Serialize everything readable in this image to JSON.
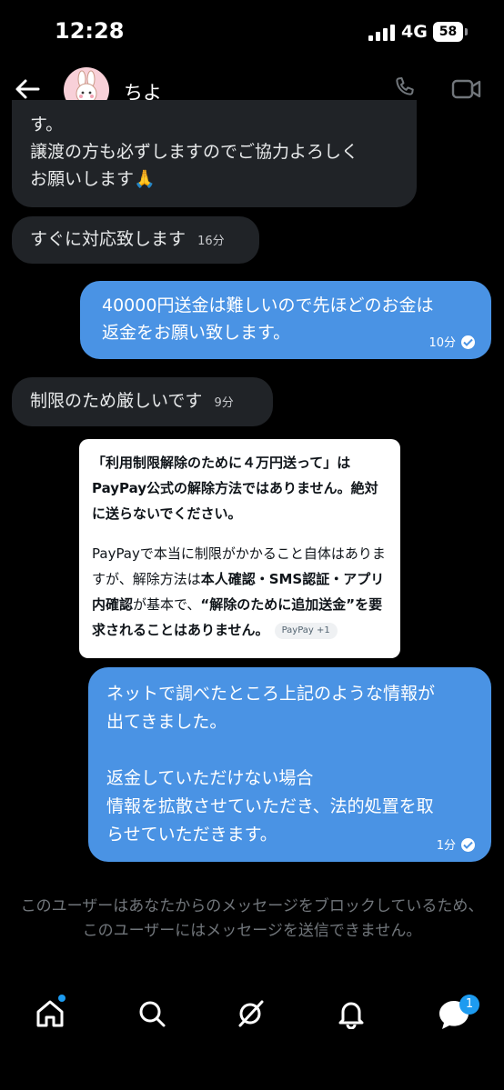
{
  "status_bar": {
    "time": "12:28",
    "network": "4G",
    "battery": "58"
  },
  "header": {
    "contact_name": "ちよ"
  },
  "messages": [
    {
      "direction": "received",
      "text": "す。\n譲渡の方も必ずしますのでご協力よろしく\nお願いします🙏",
      "time": ""
    },
    {
      "direction": "received",
      "text": "すぐに対応致します",
      "time": "16分"
    },
    {
      "direction": "sent",
      "text": "40000円送金は難しいので先ほどのお金は\n返金をお願い致します。",
      "time": "10分"
    },
    {
      "direction": "received",
      "text": "制限のため厳しいです",
      "time": "9分"
    },
    {
      "direction": "sent",
      "text": "ネットで調べたところ上記のような情報が\n出てきました。\n\n返金していただけない場合\n情報を拡散させていただき、法的処置を取\nらせていただきます。",
      "time": "1分"
    }
  ],
  "screenshot_card": {
    "para1": "「利用制限解除のために４万円送って」はPayPay公式の解除方法ではありません。絶対に送らないでください。",
    "para2_intro": "PayPayで本当に制限がかかること自体はありますが、解除方法は",
    "para2_bold1": "本人確認・SMS認証・アプリ内確認",
    "para2_mid": "が基本で、",
    "para2_bold2": "“解除のために追加送金”を要求されることはありません。",
    "source_chip": "PayPay +1"
  },
  "blocked_notice": "このユーザーはあなたからのメッセージをブロックしているため、このユーザーにはメッセージを送信できません。",
  "tab_bar": {
    "messages_badge": "1"
  },
  "colors": {
    "sent_bubble": "#4a93e4",
    "received_bubble": "#202327",
    "accent": "#1d9bf0"
  }
}
